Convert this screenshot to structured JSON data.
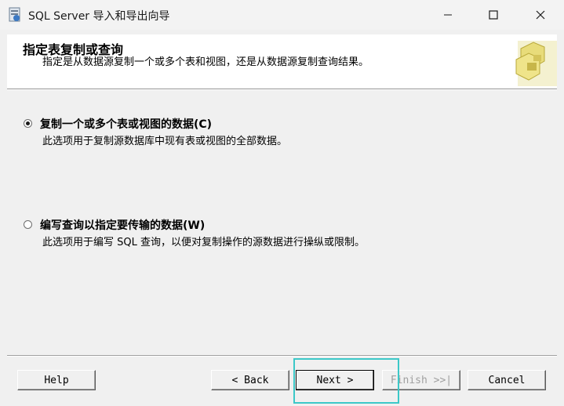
{
  "window": {
    "title": "SQL Server 导入和导出向导"
  },
  "header": {
    "title": "指定表复制或查询",
    "description": "指定是从数据源复制一个或多个表和视图，还是从数据源复制查询结果。"
  },
  "options": [
    {
      "label": "复制一个或多个表或视图的数据(C)",
      "description": "此选项用于复制源数据库中现有表或视图的全部数据。",
      "selected": true
    },
    {
      "label": "编写查询以指定要传输的数据(W)",
      "description": "此选项用于编写 SQL 查询，以便对复制操作的源数据进行操纵或限制。",
      "selected": false
    }
  ],
  "buttons": {
    "help": "Help",
    "back": "< Back",
    "next": "Next >",
    "finish": "Finish >>|",
    "cancel": "Cancel"
  },
  "colors": {
    "focus_highlight": "#3cc8c8",
    "disabled_text": "#a0a0a0"
  }
}
